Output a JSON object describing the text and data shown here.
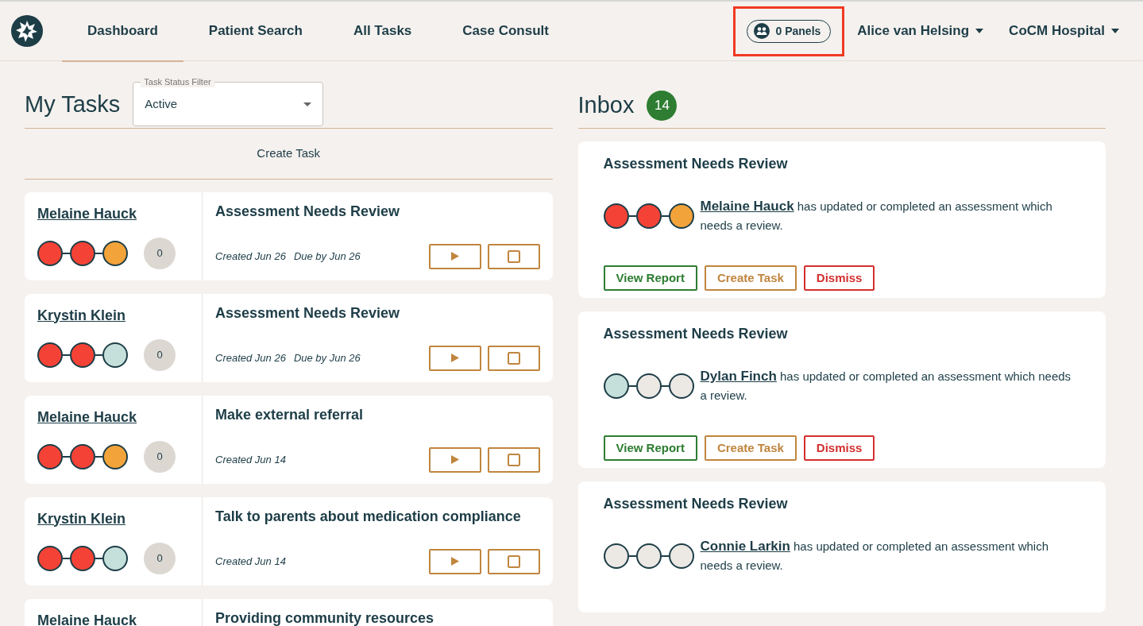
{
  "nav": {
    "links": [
      {
        "label": "Dashboard",
        "selected": true
      },
      {
        "label": "Patient Search",
        "selected": false
      },
      {
        "label": "All Tasks",
        "selected": false
      },
      {
        "label": "Case Consult",
        "selected": false
      }
    ],
    "panels": {
      "label": "0 Panels",
      "highlighted": true
    },
    "menus": [
      "Alice van Helsing",
      "CoCM Hospital"
    ]
  },
  "tasks": {
    "title": "My Tasks",
    "filter": {
      "label": "Task Status Filter",
      "value": "Active"
    },
    "create": "Create Task",
    "items": [
      {
        "patient": "Melaine Hauck",
        "dots": [
          {
            "color": "#f44336"
          },
          {
            "color": "#f44336"
          },
          {
            "color": "#f2a33a"
          }
        ],
        "count": "0",
        "title": "Assessment Needs Review",
        "dates": [
          "Created Jun 26",
          "Due by Jun 26"
        ]
      },
      {
        "patient": "Krystin Klein",
        "dots": [
          {
            "color": "#f44336"
          },
          {
            "color": "#f44336"
          },
          {
            "color": "#c5e0da"
          }
        ],
        "count": "0",
        "title": "Assessment Needs Review",
        "dates": [
          "Created Jun 26",
          "Due by Jun 26"
        ]
      },
      {
        "patient": "Melaine Hauck",
        "dots": [
          {
            "color": "#f44336"
          },
          {
            "color": "#f44336"
          },
          {
            "color": "#f2a33a"
          }
        ],
        "count": "0",
        "title": "Make external referral",
        "dates": [
          "Created Jun 14"
        ]
      },
      {
        "patient": "Krystin Klein",
        "dots": [
          {
            "color": "#f44336"
          },
          {
            "color": "#f44336"
          },
          {
            "color": "#c5e0da"
          }
        ],
        "count": "0",
        "title": "Talk to parents about medication compliance",
        "dates": [
          "Created Jun 14"
        ]
      },
      {
        "patient": "Melaine Hauck",
        "title": "Providing community resources"
      }
    ]
  },
  "inbox": {
    "title": "Inbox",
    "count": "14",
    "items": [
      {
        "title": "Assessment Needs Review",
        "dots": [
          {
            "color": "#f44336"
          },
          {
            "color": "#f44336"
          },
          {
            "color": "#f2a33a"
          }
        ],
        "patient": "Melaine Hauck",
        "message": " has updated or completed an assessment which needs a review.",
        "actions": [
          {
            "label": "View Report",
            "kind": "view"
          },
          {
            "label": "Create Task",
            "kind": "create"
          },
          {
            "label": "Dismiss",
            "kind": "dismiss"
          }
        ]
      },
      {
        "title": "Assessment Needs Review",
        "dots": [
          {
            "color": "#c5e0da"
          },
          {
            "color": "#ece8e4"
          },
          {
            "color": "#ece8e4"
          }
        ],
        "patient": "Dylan Finch",
        "message": " has updated or completed an assessment which needs a review.",
        "actions": [
          {
            "label": "View Report",
            "kind": "view"
          },
          {
            "label": "Create Task",
            "kind": "create"
          },
          {
            "label": "Dismiss",
            "kind": "dismiss"
          }
        ]
      },
      {
        "title": "Assessment Needs Review",
        "dots": [
          {
            "color": "#ece8e4"
          },
          {
            "color": "#ece8e4"
          },
          {
            "color": "#ece8e4"
          }
        ],
        "patient": "Connie Larkin",
        "message": " has updated or completed an assessment which needs a review."
      }
    ]
  }
}
